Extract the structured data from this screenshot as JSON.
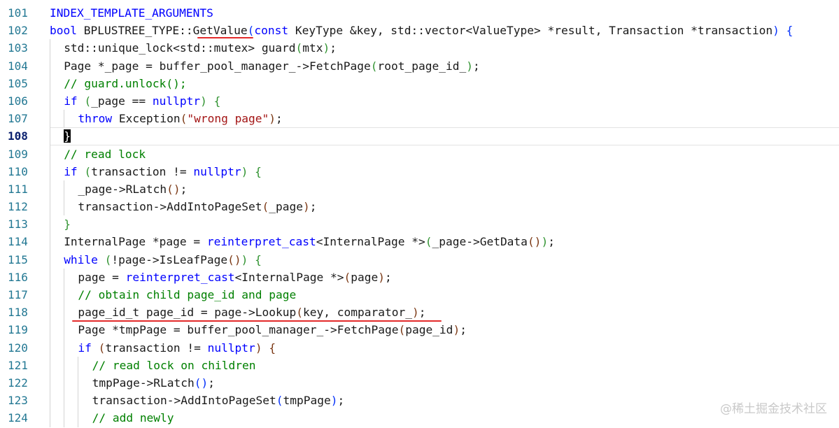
{
  "editor": {
    "lines": [
      {
        "num": "101",
        "indent": 0,
        "tokens": [
          [
            "INDEX_TEMPLATE_ARGUMENTS",
            "t-macro"
          ]
        ]
      },
      {
        "num": "102",
        "indent": 0,
        "tokens": [
          [
            "bool",
            "t-kw"
          ],
          [
            " BPLUSTREE_TYPE::",
            ""
          ],
          [
            "GetValue",
            ""
          ],
          [
            "(",
            "t-paren1"
          ],
          [
            "const",
            "t-kw"
          ],
          [
            " KeyType &key, std::vector<ValueType> *result, Transaction *transaction",
            ""
          ],
          [
            ")",
            "t-paren1"
          ],
          [
            " ",
            ""
          ],
          [
            "{",
            "t-paren1"
          ]
        ]
      },
      {
        "num": "103",
        "indent": 1,
        "tokens": [
          [
            "std::unique_lock<std::mutex> guard",
            ""
          ],
          [
            "(",
            "t-paren2"
          ],
          [
            "mtx",
            ""
          ],
          [
            ")",
            "t-paren2"
          ],
          [
            ";",
            ""
          ]
        ]
      },
      {
        "num": "104",
        "indent": 1,
        "tokens": [
          [
            "Page *_page = buffer_pool_manager_->FetchPage",
            ""
          ],
          [
            "(",
            "t-paren2"
          ],
          [
            "root_page_id_",
            ""
          ],
          [
            ")",
            "t-paren2"
          ],
          [
            ";",
            ""
          ]
        ]
      },
      {
        "num": "105",
        "indent": 1,
        "tokens": [
          [
            "// guard.unlock();",
            "t-cmt"
          ]
        ]
      },
      {
        "num": "106",
        "indent": 1,
        "tokens": [
          [
            "if",
            "t-kw"
          ],
          [
            " ",
            ""
          ],
          [
            "(",
            "t-paren2"
          ],
          [
            "_page == ",
            ""
          ],
          [
            "nullptr",
            "t-kw"
          ],
          [
            ")",
            "t-paren2"
          ],
          [
            " ",
            ""
          ],
          [
            "{",
            "t-paren2"
          ]
        ]
      },
      {
        "num": "107",
        "indent": 2,
        "tokens": [
          [
            "throw",
            "t-kw"
          ],
          [
            " Exception",
            ""
          ],
          [
            "(",
            "t-paren3"
          ],
          [
            "\"wrong page\"",
            "t-str"
          ],
          [
            ")",
            "t-paren3"
          ],
          [
            ";",
            ""
          ]
        ]
      },
      {
        "num": "108",
        "indent": 1,
        "current": true,
        "tokens": [
          [
            "}",
            "cursor-bracket"
          ]
        ]
      },
      {
        "num": "109",
        "indent": 1,
        "tokens": [
          [
            "// read lock",
            "t-cmt"
          ]
        ]
      },
      {
        "num": "110",
        "indent": 1,
        "tokens": [
          [
            "if",
            "t-kw"
          ],
          [
            " ",
            ""
          ],
          [
            "(",
            "t-paren2"
          ],
          [
            "transaction != ",
            ""
          ],
          [
            "nullptr",
            "t-kw"
          ],
          [
            ")",
            "t-paren2"
          ],
          [
            " ",
            ""
          ],
          [
            "{",
            "t-paren2"
          ]
        ]
      },
      {
        "num": "111",
        "indent": 2,
        "tokens": [
          [
            "_page->RLatch",
            ""
          ],
          [
            "()",
            "t-paren3"
          ],
          [
            ";",
            ""
          ]
        ]
      },
      {
        "num": "112",
        "indent": 2,
        "tokens": [
          [
            "transaction->AddIntoPageSet",
            ""
          ],
          [
            "(",
            "t-paren3"
          ],
          [
            "_page",
            ""
          ],
          [
            ")",
            "t-paren3"
          ],
          [
            ";",
            ""
          ]
        ]
      },
      {
        "num": "113",
        "indent": 1,
        "tokens": [
          [
            "}",
            "t-paren2"
          ]
        ]
      },
      {
        "num": "114",
        "indent": 1,
        "tokens": [
          [
            "InternalPage *page = ",
            ""
          ],
          [
            "reinterpret_cast",
            "t-kw"
          ],
          [
            "<InternalPage *>",
            ""
          ],
          [
            "(",
            "t-paren2"
          ],
          [
            "_page->GetData",
            ""
          ],
          [
            "()",
            "t-paren3"
          ],
          [
            ")",
            "t-paren2"
          ],
          [
            ";",
            ""
          ]
        ]
      },
      {
        "num": "115",
        "indent": 1,
        "tokens": [
          [
            "while",
            "t-kw"
          ],
          [
            " ",
            ""
          ],
          [
            "(",
            "t-paren2"
          ],
          [
            "!page->IsLeafPage",
            ""
          ],
          [
            "()",
            "t-paren3"
          ],
          [
            ")",
            "t-paren2"
          ],
          [
            " ",
            ""
          ],
          [
            "{",
            "t-paren2"
          ]
        ]
      },
      {
        "num": "116",
        "indent": 2,
        "tokens": [
          [
            "page = ",
            ""
          ],
          [
            "reinterpret_cast",
            "t-kw"
          ],
          [
            "<InternalPage *>",
            ""
          ],
          [
            "(",
            "t-paren3"
          ],
          [
            "page",
            ""
          ],
          [
            ")",
            "t-paren3"
          ],
          [
            ";",
            ""
          ]
        ]
      },
      {
        "num": "117",
        "indent": 2,
        "tokens": [
          [
            "// obtain child page_id and page",
            "t-cmt"
          ]
        ]
      },
      {
        "num": "118",
        "indent": 2,
        "tokens": [
          [
            "page_id_t page_id = page->Lookup",
            ""
          ],
          [
            "(",
            "t-paren3"
          ],
          [
            "key, comparator_",
            ""
          ],
          [
            ")",
            "t-paren3"
          ],
          [
            ";",
            ""
          ]
        ]
      },
      {
        "num": "119",
        "indent": 2,
        "tokens": [
          [
            "Page *tmpPage = buffer_pool_manager_->FetchPage",
            ""
          ],
          [
            "(",
            "t-paren3"
          ],
          [
            "page_id",
            ""
          ],
          [
            ")",
            "t-paren3"
          ],
          [
            ";",
            ""
          ]
        ]
      },
      {
        "num": "120",
        "indent": 2,
        "tokens": [
          [
            "if",
            "t-kw"
          ],
          [
            " ",
            ""
          ],
          [
            "(",
            "t-paren3"
          ],
          [
            "transaction != ",
            ""
          ],
          [
            "nullptr",
            "t-kw"
          ],
          [
            ")",
            "t-paren3"
          ],
          [
            " ",
            ""
          ],
          [
            "{",
            "t-paren3"
          ]
        ]
      },
      {
        "num": "121",
        "indent": 3,
        "tokens": [
          [
            "// read lock on children",
            "t-cmt"
          ]
        ]
      },
      {
        "num": "122",
        "indent": 3,
        "tokens": [
          [
            "tmpPage->RLatch",
            ""
          ],
          [
            "()",
            "t-paren1"
          ],
          [
            ";",
            ""
          ]
        ]
      },
      {
        "num": "123",
        "indent": 3,
        "tokens": [
          [
            "transaction->AddIntoPageSet",
            ""
          ],
          [
            "(",
            "t-paren1"
          ],
          [
            "tmpPage",
            ""
          ],
          [
            ")",
            "t-paren1"
          ],
          [
            ";",
            ""
          ]
        ]
      },
      {
        "num": "124",
        "indent": 3,
        "tokens": [
          [
            "// add newly",
            "t-cmt"
          ]
        ]
      }
    ]
  },
  "watermark": "@稀土掘金技术社区"
}
